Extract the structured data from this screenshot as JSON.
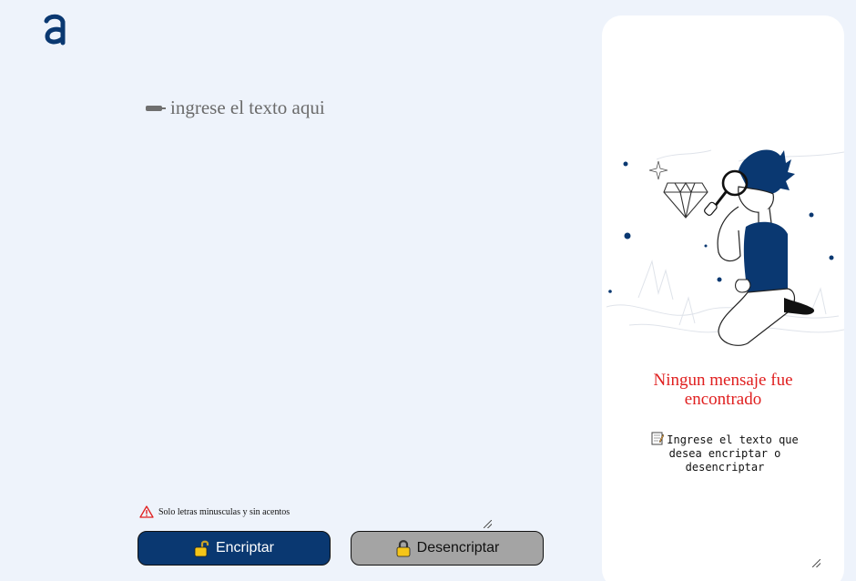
{
  "logo": {
    "icon": "alura-logo-icon"
  },
  "input": {
    "placeholder": "ingrese el texto aqui",
    "value": "",
    "icon": "pen-icon"
  },
  "hint": {
    "icon": "warning-icon",
    "text": "Solo letras minusculas y sin acentos"
  },
  "buttons": {
    "encrypt_label": "Encriptar",
    "decrypt_label": "Desencriptar"
  },
  "result": {
    "title": "Ningun mensaje fue encontrado",
    "body": "Ingrese el texto que desea encriptar o desencriptar",
    "body_icon": "memo-icon",
    "illustration": "person-with-magnifying-glass-illustration"
  },
  "colors": {
    "background": "#eef3fb",
    "primary": "#0a3871",
    "secondary_button": "#a4a4a4",
    "alert_text": "#e01f1f",
    "panel": "#ffffff"
  }
}
